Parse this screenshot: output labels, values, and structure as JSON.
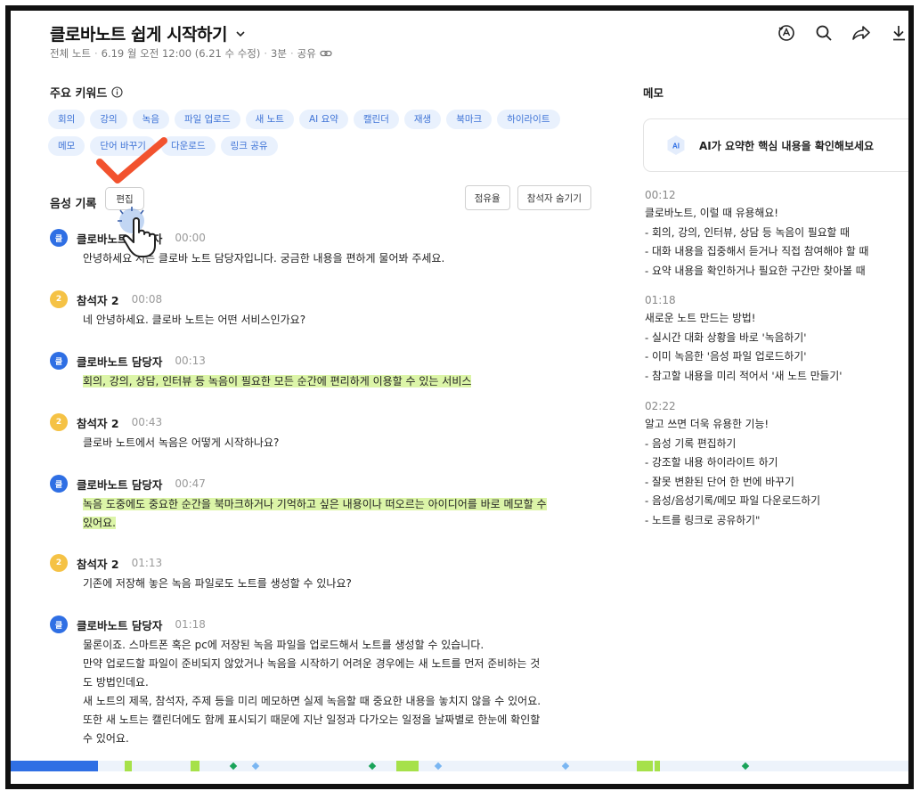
{
  "header": {
    "title": "클로바노트 쉽게 시작하기",
    "meta": {
      "folder": "전체 노트",
      "created": "6.19 월 오전 12:00 (6.21 수 수정)",
      "duration": "3분",
      "share": "공유"
    },
    "toolbar_icons": [
      "ai-summary-icon",
      "search-icon",
      "share-icon",
      "download-icon"
    ]
  },
  "keywords": {
    "heading": "주요 키워드",
    "items": [
      "회의",
      "강의",
      "녹음",
      "파일 업로드",
      "새 노트",
      "AI 요약",
      "캘린더",
      "재생",
      "북마크",
      "하이라이트",
      "메모",
      "단어 바꾸기",
      "다운로드",
      "링크 공유"
    ]
  },
  "voice": {
    "heading": "음성 기록",
    "edit_label": "편집",
    "share_ratio_label": "점유율",
    "hide_participants_label": "참석자 숨기기"
  },
  "transcript": [
    {
      "speaker": "클로바노트 담당자",
      "avatar": "클",
      "color": "blue",
      "time": "00:00",
      "lines": [
        "안녕하세요 저는 클로바 노트 담당자입니다. 궁금한 내용을 편하게 물어봐 주세요."
      ],
      "highlight": false
    },
    {
      "speaker": "참석자 2",
      "avatar": "2",
      "color": "yellow",
      "time": "00:08",
      "lines": [
        "네 안녕하세요. 클로바 노트는 어떤 서비스인가요?"
      ],
      "highlight": false
    },
    {
      "speaker": "클로바노트 담당자",
      "avatar": "클",
      "color": "blue",
      "time": "00:13",
      "lines": [
        "회의, 강의, 상담, 인터뷰 등 녹음이 필요한 모든 순간에 편리하게 이용할 수 있는 서비스"
      ],
      "highlight": true
    },
    {
      "speaker": "참석자 2",
      "avatar": "2",
      "color": "yellow",
      "time": "00:43",
      "lines": [
        "클로바 노트에서 녹음은 어떻게 시작하나요?"
      ],
      "highlight": false
    },
    {
      "speaker": "클로바노트 담당자",
      "avatar": "클",
      "color": "blue",
      "time": "00:47",
      "lines": [
        "녹음 도중에도 중요한 순간을 북마크하거나 기억하고 싶은 내용이나 떠오르는 아이디어를 바로 메모할 수",
        "있어요."
      ],
      "highlight": true
    },
    {
      "speaker": "참석자 2",
      "avatar": "2",
      "color": "yellow",
      "time": "01:13",
      "lines": [
        "기존에 저장해 놓은 녹음 파일로도 노트를 생성할 수 있나요?"
      ],
      "highlight": false
    },
    {
      "speaker": "클로바노트 담당자",
      "avatar": "클",
      "color": "blue",
      "time": "01:18",
      "lines": [
        "물론이죠. 스마트폰 혹은 pc에 저장된 녹음 파일을 업로드해서 노트를 생성할 수 있습니다.",
        "만약 업로드할 파일이 준비되지 않았거나 녹음을 시작하기 어려운 경우에는 새 노트를 먼저 준비하는 것",
        "도 방법인데요.",
        "새 노트의 제목, 참석자, 주제 등을 미리 메모하면 실제 녹음할 때 중요한 내용을 놓치지 않을 수 있어요.",
        "또한 새 노트는 캘린더에도 함께 표시되기 때문에 지난 일정과 다가오는 일정을 날짜별로 한눈에 확인할",
        "수 있어요."
      ],
      "highlight": false
    }
  ],
  "memo": {
    "heading": "메모",
    "ai_badge": "AI",
    "ai_prompt": "AI가 요약한 핵심 내용을 확인해보세요",
    "blocks": [
      {
        "time": "00:12",
        "lines": [
          "클로바노트, 이럴 때 유용해요!",
          "- 회의, 강의, 인터뷰, 상담 등 녹음이 필요할 때",
          "- 대화 내용을 집중해서 듣거나 직접 참여해야 할 때",
          "- 요약 내용을 확인하거나 필요한 구간만 찾아볼 때"
        ]
      },
      {
        "time": "01:18",
        "lines": [
          "새로운 노트 만드는 방법!",
          "- 실시간 대화 상황을 바로 '녹음하기'",
          "- 이미 녹음한 '음성 파일 업로드하기'",
          "- 참고할 내용을 미리 적어서 '새 노트 만들기'"
        ]
      },
      {
        "time": "02:22",
        "lines": [
          "알고 쓰면 더욱 유용한 기능!",
          "- 음성 기록 편집하기",
          "- 강조할 내용 하이라이트 하기",
          "- 잘못 변환된 단어 한 번에 바꾸기",
          "- 음성/음성기록/메모 파일 다운로드하기",
          "- 노트를 링크로 공유하기\""
        ]
      }
    ]
  },
  "colors": {
    "accent": "#2f6fe4",
    "keyword_bg": "#e9f1fd",
    "keyword_text": "#3e73d6",
    "highlight": "#dcf5a8",
    "participant": "#f5c245",
    "check": "#f2522e"
  },
  "timeline": {
    "progress": 0.097,
    "green_marks": [
      0.127,
      0.2,
      0.43,
      0.697,
      0.717
    ],
    "green_widths": [
      0.008,
      0.01,
      0.025,
      0.018,
      0.006
    ],
    "memo_marks": [
      0.245,
      0.4,
      0.815
    ],
    "bookmark_marks": [
      0.27,
      0.473,
      0.615
    ]
  }
}
